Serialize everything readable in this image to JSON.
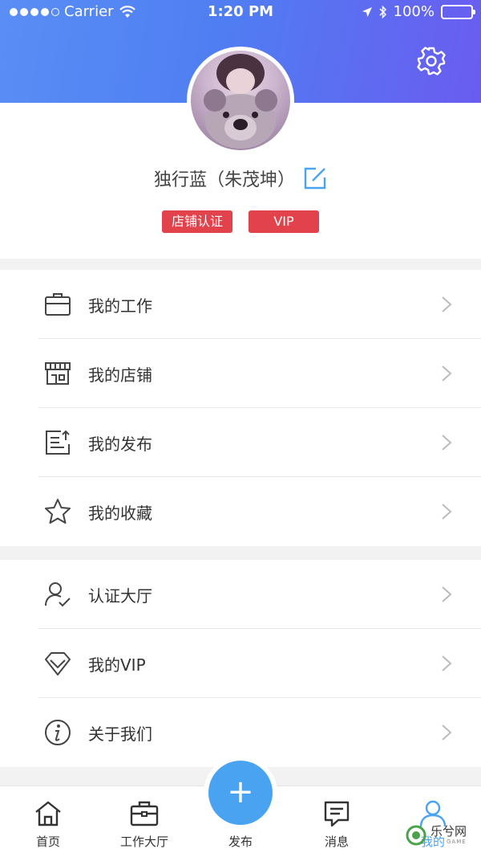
{
  "status_bar": {
    "carrier": "Carrier",
    "time": "1:20 PM",
    "battery": "100%",
    "battery_level": 1.0
  },
  "profile": {
    "name": "独行蓝（朱茂坤）",
    "badges": [
      "店铺认证",
      "VIP"
    ]
  },
  "menu_group_1": [
    {
      "label": "我的工作",
      "icon": "briefcase-icon"
    },
    {
      "label": "我的店铺",
      "icon": "store-icon"
    },
    {
      "label": "我的发布",
      "icon": "publish-list-icon"
    },
    {
      "label": "我的收藏",
      "icon": "star-icon"
    }
  ],
  "menu_group_2": [
    {
      "label": "认证大厅",
      "icon": "user-verify-icon"
    },
    {
      "label": "我的VIP",
      "icon": "diamond-icon"
    },
    {
      "label": "关于我们",
      "icon": "info-icon"
    }
  ],
  "tabbar": {
    "tabs": [
      {
        "label": "首页",
        "icon": "home-icon"
      },
      {
        "label": "工作大厅",
        "icon": "briefcase-icon"
      },
      {
        "label": "发布",
        "icon": "plus-icon"
      },
      {
        "label": "消息",
        "icon": "message-icon"
      },
      {
        "label": "我的",
        "icon": "user-icon"
      }
    ],
    "active_index": 4
  },
  "watermark": {
    "text": "乐兮网",
    "sub": "GAME"
  },
  "colors": {
    "header_gradient_start": "#5a8ef5",
    "header_gradient_end": "#6a5cf0",
    "badge_red": "#e2424b",
    "accent_blue": "#4aa3f0"
  }
}
